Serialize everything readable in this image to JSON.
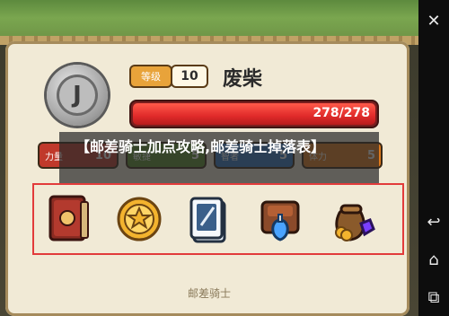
{
  "player": {
    "level_label": "等级",
    "level_value": "10",
    "name": "废柴",
    "hp_text": "278/278",
    "hp_fraction": 1.0,
    "avatar_letter": "J"
  },
  "stats": [
    {
      "label": "力量",
      "value": "10",
      "color": "#c0392b"
    },
    {
      "label": "敏捷",
      "value": "5",
      "color": "#5b8f2e"
    },
    {
      "label": "智者",
      "value": "5",
      "color": "#2f78c4"
    },
    {
      "label": "体力",
      "value": "5",
      "color": "#e07b1e"
    }
  ],
  "overlay_title": "【邮差骑士加点攻略,邮差骑士掉落表】",
  "items": [
    "red-book-icon",
    "gold-coin-icon",
    "card-deck-icon",
    "potion-bag-icon",
    "treasure-sack-icon"
  ],
  "footer": "邮差骑士",
  "sidebar_buttons": [
    "close-icon",
    "back-icon",
    "home-icon",
    "recent-apps-icon"
  ]
}
